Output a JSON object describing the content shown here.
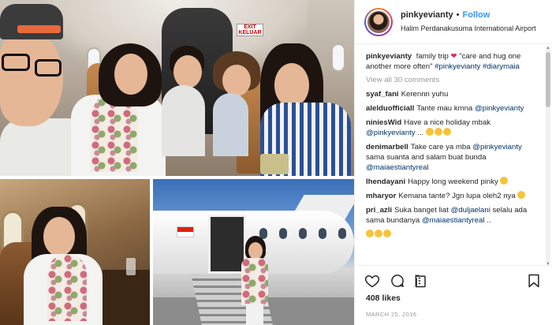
{
  "header": {
    "username": "pinkyevianty",
    "separator": "•",
    "follow_label": "Follow",
    "location": "Halim Perdanakusuma International Airport"
  },
  "caption": {
    "username": "pinkyevianty",
    "text": "family trip",
    "quote": "\"care and hug one another more often\"",
    "tags": [
      "#pinkyevianty",
      "#diarymaia"
    ]
  },
  "view_all_label": "View all 30 comments",
  "comments": [
    {
      "user": "syaf_fani",
      "text": "Kerennn yuhu"
    },
    {
      "user": "alelduofficiall",
      "text": "Tante mau kmna",
      "mention": "@pinkyevianty"
    },
    {
      "user": "niniesWid",
      "text": "Have a nice holiday mbak",
      "mention": "@pinkyevianty",
      "suffix": " ..."
    },
    {
      "user": "denimarbell",
      "text": "Take care ya mba",
      "mention": "@pinkyevianty",
      "suffix": " sama suanta and salam buat bunda ",
      "mention2": "@maiaestiantyreal"
    },
    {
      "user": "lhendayani",
      "text": "Happy long weekend pinky"
    },
    {
      "user": "mharyor",
      "text": "Kemana tante? Jgn lupa oleh2 nya"
    },
    {
      "user": "pri_azli",
      "text": "Suka banget liat ",
      "mention": "@duljaelani",
      "suffix": " selalu ada sama bundanya ",
      "mention2": "@maiaestiantyreal",
      "suffix2": " .."
    }
  ],
  "actions": {
    "like_icon": "heart-outline-icon",
    "comment_icon": "comment-bubble-icon",
    "share_icon": "share-plane-icon",
    "save_icon": "bookmark-icon"
  },
  "likes": {
    "count": "408",
    "label": "likes"
  },
  "date": "MARCH 25, 2016",
  "photo": {
    "exit_sign": "EXIT\nKELUAR"
  },
  "colors": {
    "link": "#003569",
    "follow": "#3897f0",
    "heart": "#e0245e"
  }
}
